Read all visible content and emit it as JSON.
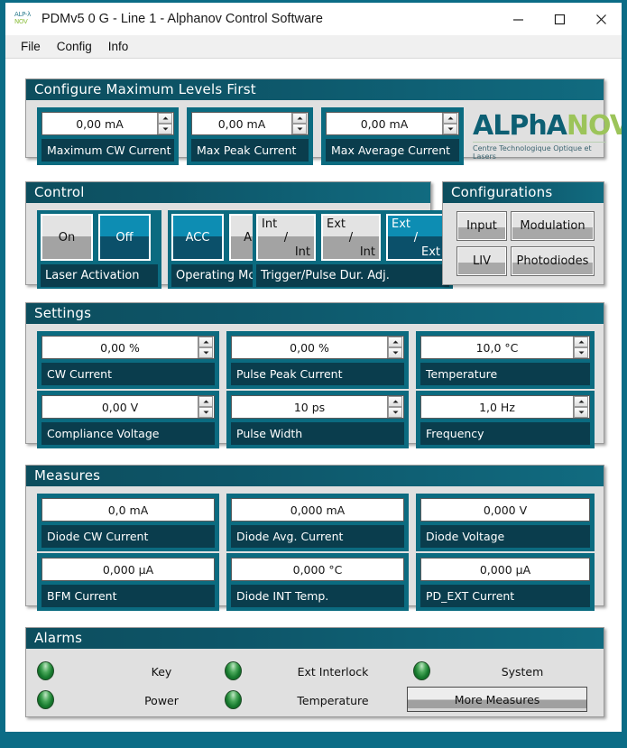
{
  "window": {
    "title": "PDMv5 0 G - Line 1 - Alphanov Control Software",
    "icon": "alphanov-logo-icon",
    "minimize": "minimize-icon",
    "maximize": "maximize-icon",
    "close": "close-icon",
    "accent_teal": "#0b6b80",
    "accent_dark": "#0a3d4d",
    "selected_blue": "#0d8db3",
    "panel_bg": "#e0e0e0",
    "led_green": "#177a2e"
  },
  "menubar": {
    "items": [
      "File",
      "Config",
      "Info"
    ]
  },
  "maxlevels": {
    "title": "Configure Maximum Levels First",
    "fields": [
      {
        "value": "0,00 mA",
        "label": "Maximum CW Current"
      },
      {
        "value": "0,00 mA",
        "label": "Max Peak Current"
      },
      {
        "value": "0,00 mA",
        "label": "Max Average Current"
      }
    ],
    "logo": {
      "part1": "ALPhA",
      "part2": "NOV",
      "tagline": "Centre Technologique Optique et Lasers"
    }
  },
  "control": {
    "title": "Control",
    "groups": [
      {
        "label": "Laser Activation",
        "buttons": [
          {
            "text": "On",
            "selected": false
          },
          {
            "text": "Off",
            "selected": true
          }
        ]
      },
      {
        "label": "Operating Mode",
        "buttons": [
          {
            "text": "ACC",
            "selected": true
          },
          {
            "text": "APC",
            "selected": false
          }
        ]
      }
    ],
    "trigger": {
      "label": "Trigger/Pulse Dur. Adj.",
      "buttons": [
        {
          "top": "Int",
          "mid": "/",
          "bottom": "Int",
          "selected": false
        },
        {
          "top": "Ext",
          "mid": "/",
          "bottom": "Int",
          "selected": false
        },
        {
          "top": "Ext",
          "mid": "/",
          "bottom": "Ext",
          "selected": true
        }
      ]
    }
  },
  "configurations": {
    "title": "Configurations",
    "buttons": [
      "Input",
      "Modulation",
      "LIV",
      "Photodiodes"
    ]
  },
  "settings": {
    "title": "Settings",
    "fields": [
      {
        "value": "0,00 %",
        "label": "CW Current"
      },
      {
        "value": "0,00 %",
        "label": "Pulse Peak Current"
      },
      {
        "value": "10,0 °C",
        "label": "Temperature"
      },
      {
        "value": "0,00 V",
        "label": "Compliance Voltage"
      },
      {
        "value": "10 ps",
        "label": "Pulse Width"
      },
      {
        "value": "1,0 Hz",
        "label": "Frequency"
      }
    ]
  },
  "measures": {
    "title": "Measures",
    "fields": [
      {
        "value": "0,0 mA",
        "label": "Diode CW Current"
      },
      {
        "value": "0,000 mA",
        "label": "Diode Avg. Current"
      },
      {
        "value": "0,000 V",
        "label": "Diode Voltage"
      },
      {
        "value": "0,000 µA",
        "label": "BFM Current"
      },
      {
        "value": "0,000 °C",
        "label": "Diode INT Temp."
      },
      {
        "value": "0,000 µA",
        "label": "PD_EXT Current"
      }
    ]
  },
  "alarms": {
    "title": "Alarms",
    "indicators": [
      {
        "label": "Key",
        "state": "green"
      },
      {
        "label": "Ext Interlock",
        "state": "green"
      },
      {
        "label": "System",
        "state": "green"
      },
      {
        "label": "Power",
        "state": "green"
      },
      {
        "label": "Temperature",
        "state": "green"
      }
    ],
    "more_button": "More Measures"
  }
}
